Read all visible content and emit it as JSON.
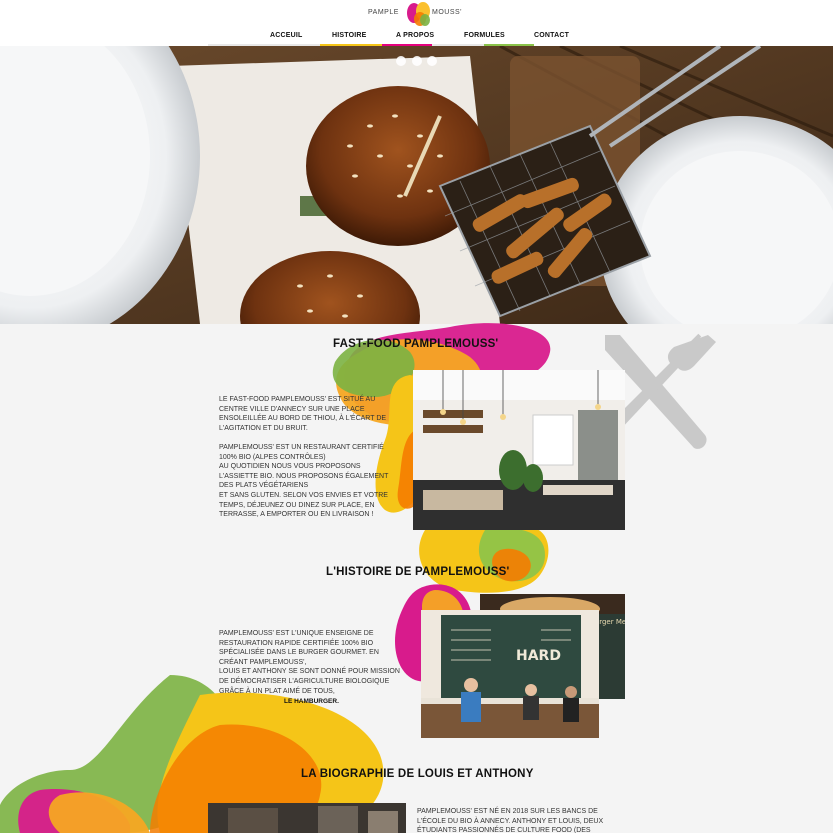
{
  "header": {
    "logo_left": "PAMPLE",
    "logo_right": "MOUSS'",
    "nav": [
      {
        "label": "ACCEUIL"
      },
      {
        "label": "HISTOIRE"
      },
      {
        "label": "A PROPOS"
      },
      {
        "label": "FORMULES"
      },
      {
        "label": "CONTACT"
      }
    ],
    "nav_colors": [
      "#e8e8e8",
      "#f5c518",
      "#e6007e",
      "#e8e8e8",
      "#8bc34a"
    ]
  },
  "hero": {
    "slide_dots": 3
  },
  "section1": {
    "title": "FAST-FOOD PAMPLEMOUSS'",
    "text": "LE FAST-FOOD PAMPLEMOUSS' EST SITUÉ AU\nCENTRE VILLE D'ANNECY SUR UNE PLACE\nENSOLEILLÉE AU BORD DE THIOU, À L'ÉCART DE\nL'AGITATION ET DU BRUIT.\n\nPAMPLEMOUSS' EST UN RESTAURANT CERTIFIÉ\n100% BIO (ALPES CONTRÔLES)\nAU QUOTIDIEN NOUS VOUS PROPOSONS\nL'ASSIETTE BIO. NOUS PROPOSONS ÉGALEMENT\nDES PLATS VÉGÉTARIENS\nET SANS GLUTEN. SELON VOS ENVIES ET VOTRE\nTEMPS, DÉJEUNEZ OU DINEZ SUR PLACE, EN\nTERRASSE, A EMPORTER OU EN LIVRAISON !"
  },
  "section2": {
    "title": "L'HISTOIRE DE PAMPLEMOUSS'",
    "text": "PAMPLEMOUSS' EST L'UNIQUE ENSEIGNE DE\nRESTAURATION RAPIDE CERTIFIÉE 100% BIO\nSPÉCIALISÉE DANS LE BURGER GOURMET. EN\nCRÉANT PAMPLEMOUSS',\nLOUIS ET ANTHONY SE SONT DONNÉ POUR MISSION\nDE DÉMOCRATISER L'AGRICULTURE BIOLOGIQUE\nGRÂCE À UN PLAT AIMÉ DE TOUS,",
    "highlight": "LE HAMBURGER."
  },
  "section3": {
    "title": "LA BIOGRAPHIE DE LOUIS ET ANTHONY",
    "text": "PAMPLEMOUSS' EST NÉ EN 2018 SUR LES BANCS DE\nL'ÉCOLE DU BIO À ANNECY. ANTHONY ET LOUIS, DEUX\nÉTUDIANTS PASSIONNÉS DE CULTURE FOOD (DES"
  },
  "colors": {
    "green": "#7cb342",
    "yellow": "#fbc02d",
    "orange": "#f57c00",
    "magenta": "#d81b8c",
    "cutlery": "#c9c9c9"
  }
}
